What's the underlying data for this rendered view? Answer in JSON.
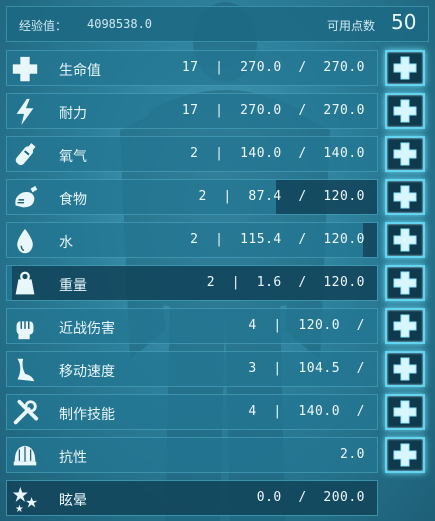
{
  "header": {
    "xp_label": "经验值：",
    "xp_value": "4098538.0",
    "points_label": "可用点数",
    "points_value": "50"
  },
  "stats": [
    {
      "icon": "health-cross-icon",
      "name": "生命值",
      "values": "17  |  270.0  /  270.0",
      "fill": 1.0,
      "has_button": true
    },
    {
      "icon": "stamina-lightning-icon",
      "name": "耐力",
      "values": "17  |  270.0  /  270.0",
      "fill": 1.0,
      "has_button": true
    },
    {
      "icon": "oxygen-tank-icon",
      "name": "氧气",
      "values": "2  |  140.0  /  140.0",
      "fill": 1.0,
      "has_button": true
    },
    {
      "icon": "food-drumstick-icon",
      "name": "食物",
      "values": "2  |  87.4  /  120.0",
      "fill": 0.728,
      "has_button": true
    },
    {
      "icon": "water-drop-icon",
      "name": "水",
      "values": "2  |  115.4  /  120.0",
      "fill": 0.962,
      "has_button": true
    },
    {
      "icon": "weight-icon",
      "name": "重量",
      "values": "2  |  1.6  /  120.0",
      "fill": 0.013,
      "has_button": true
    },
    {
      "icon": "melee-fist-icon",
      "name": "近战伤害",
      "values": "4  |  120.0  /",
      "fill": 1.0,
      "has_button": true
    },
    {
      "icon": "movement-speed-icon",
      "name": "移动速度",
      "values": "3  |  104.5  /",
      "fill": 1.0,
      "has_button": true
    },
    {
      "icon": "crafting-tools-icon",
      "name": "制作技能",
      "values": "4  |  140.0  /",
      "fill": 1.0,
      "has_button": true
    },
    {
      "icon": "fortitude-helmet-icon",
      "name": "抗性",
      "values": "2.0",
      "fill": 1.0,
      "has_button": true
    },
    {
      "icon": "torpor-stars-icon",
      "name": "眩晕",
      "values": "0.0  /  200.0",
      "fill": 0.0,
      "has_button": false
    }
  ],
  "colors": {
    "accent": "#62d4ef",
    "row_bg": "#2a7896",
    "button_bg": "#0f3a4e"
  }
}
